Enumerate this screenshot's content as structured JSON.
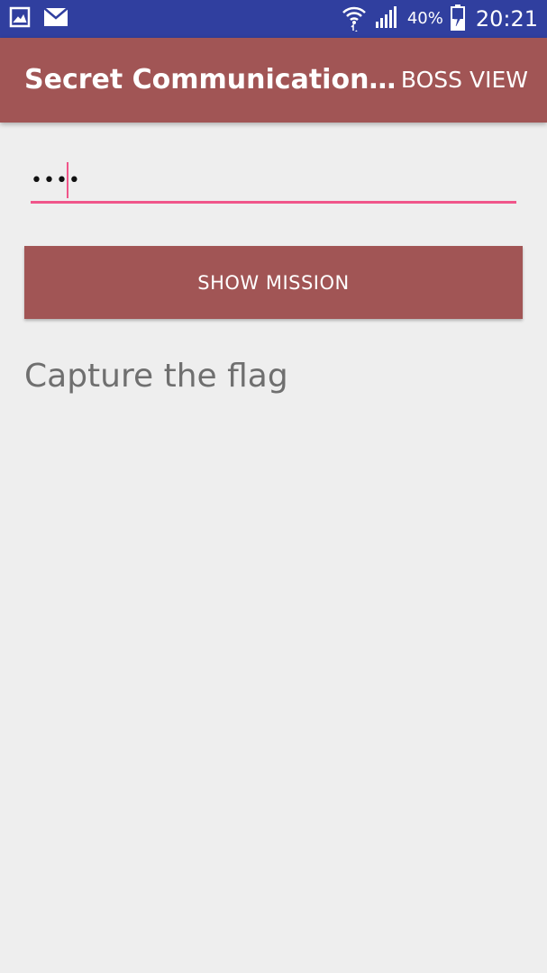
{
  "status_bar": {
    "icons_left": [
      "gallery-icon",
      "email-icon"
    ],
    "icons_right": [
      "wifi-icon",
      "signal-icon",
      "battery-charging-icon"
    ],
    "battery_percent": "40%",
    "time": "20:21",
    "background_color": "#303f9f"
  },
  "app_bar": {
    "title": "Secret Communication…",
    "action_label": "BOSS VIEW",
    "background_color": "#a15555"
  },
  "password_field": {
    "value": "••••",
    "accent_color": "#f0558a"
  },
  "show_mission_button": {
    "label": "SHOW MISSION",
    "background_color": "#a15555"
  },
  "mission": {
    "text": "Capture the flag"
  }
}
